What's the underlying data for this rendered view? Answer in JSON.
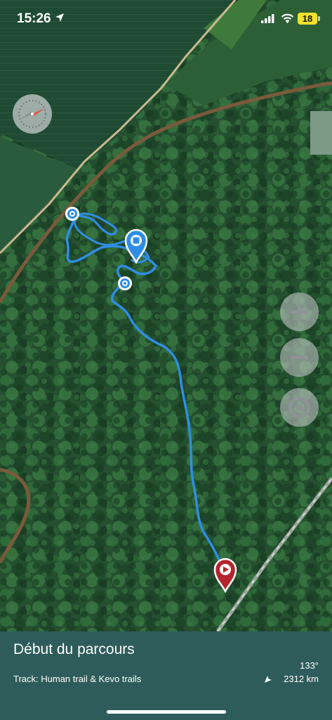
{
  "status_bar": {
    "time": "15:26",
    "battery": "18"
  },
  "map": {
    "type": "satellite",
    "track_color": "#2f8de4",
    "start_pin_color": "#b3262c",
    "waypoint_pin_color": "#2f8de4"
  },
  "icons": {
    "location": "location-arrow-icon",
    "signal": "cellular-signal-icon",
    "wifi": "wifi-icon",
    "compass": "compass-icon",
    "zoom_in": "plus-icon",
    "zoom_out": "minus-icon",
    "locate": "locate-icon",
    "heading": "heading-arrow-icon"
  },
  "info_panel": {
    "title": "Début du parcours",
    "track_label": "Track: Human trail & Kevo trails",
    "heading": "133°",
    "distance": "2312 km"
  }
}
